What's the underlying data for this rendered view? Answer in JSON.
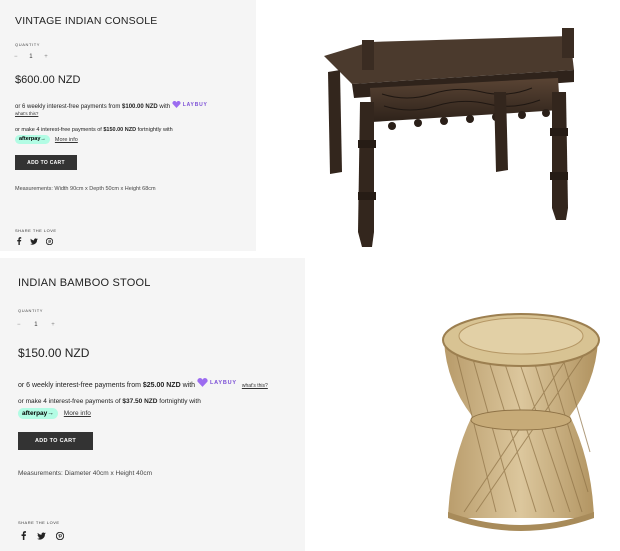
{
  "products": [
    {
      "title": "VINTAGE INDIAN CONSOLE",
      "quantity_label": "QUANTITY",
      "qty_minus": "−",
      "qty_value": "1",
      "qty_plus": "+",
      "price": "$600.00 NZD",
      "laybuy_prefix": "or 6 weekly interest-free payments from ",
      "laybuy_amount": "$100.00 NZD",
      "laybuy_with": " with ",
      "laybuy_brand": "LAYBUY",
      "laybuy_link": "what's this?",
      "afterpay_prefix": "or make 4 interest-free payments of ",
      "afterpay_amount": "$150.00 NZD",
      "afterpay_suffix": " fortnightly with",
      "afterpay_brand": "afterpay",
      "afterpay_link": "More info",
      "add_to_cart": "ADD TO CART",
      "measurements": "Measurements: Width 90cm x Depth 50cm x Height 68cm",
      "share_label": "SHARE THE LOVE"
    },
    {
      "title": "INDIAN BAMBOO STOOL",
      "quantity_label": "QUANTITY",
      "qty_minus": "−",
      "qty_value": "1",
      "qty_plus": "+",
      "price": "$150.00 NZD",
      "laybuy_prefix": "or 6 weekly interest-free payments from ",
      "laybuy_amount": "$25.00 NZD",
      "laybuy_with": " with ",
      "laybuy_brand": "LAYBUY",
      "laybuy_link": "what's this?",
      "afterpay_prefix": "or make 4 interest-free payments of ",
      "afterpay_amount": "$37.50 NZD",
      "afterpay_suffix": " fortnightly with",
      "afterpay_brand": "afterpay",
      "afterpay_link": "More info",
      "add_to_cart": "ADD TO CART",
      "measurements": "Measurements: Diameter 40cm x Height 40cm",
      "share_label": "SHARE THE LOVE"
    }
  ],
  "icons": [
    "facebook-icon",
    "twitter-icon",
    "pinterest-icon"
  ],
  "colors": {
    "panel_bg": "#f5f5f5",
    "button_bg": "#333333",
    "laybuy": "#7b4fd6",
    "afterpay": "#b2fce4",
    "wood": "#3b2a20",
    "bamboo": "#c9b184"
  }
}
